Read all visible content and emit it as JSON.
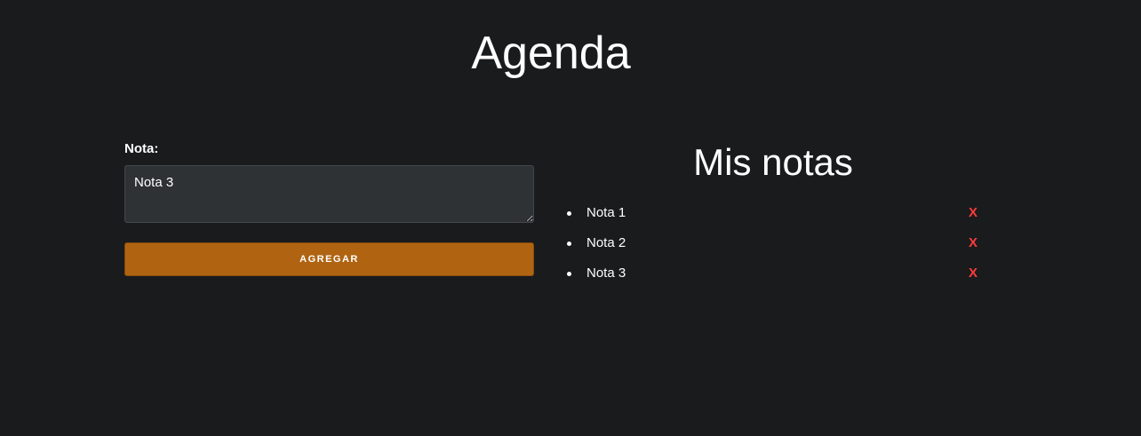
{
  "header": {
    "title": "Agenda"
  },
  "form": {
    "label": "Nota:",
    "textarea_value": "Nota 3",
    "submit_label": "AGREGAR"
  },
  "notes": {
    "title": "Mis notas",
    "delete_label": "X",
    "items": [
      {
        "text": "Nota 1"
      },
      {
        "text": "Nota 2"
      },
      {
        "text": "Nota 3"
      }
    ]
  },
  "colors": {
    "background": "#1a1b1d",
    "button": "#b06412",
    "delete": "#ff3b3b",
    "textarea": "#2f3235"
  }
}
